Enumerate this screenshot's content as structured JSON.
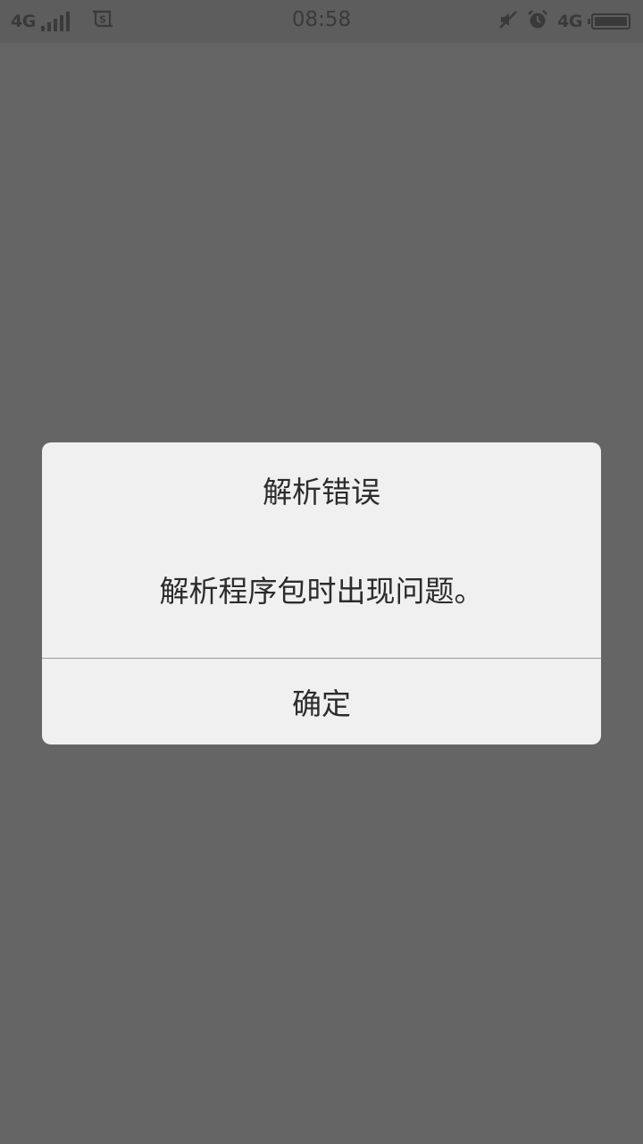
{
  "status_bar": {
    "network_left": "4G",
    "sim_icon": "sim-card-icon",
    "time": "08:58",
    "mute_icon": "muted-icon",
    "alarm_icon": "alarm-icon",
    "network_right": "4G",
    "battery_level": 1.0
  },
  "dialog": {
    "title": "解析错误",
    "message": "解析程序包时出现问题。",
    "confirm_label": "确定"
  },
  "colors": {
    "scrim": "#656565",
    "dialog_bg": "#f0f0f0",
    "text": "#2c2c2c",
    "divider": "#9a9a9a"
  }
}
